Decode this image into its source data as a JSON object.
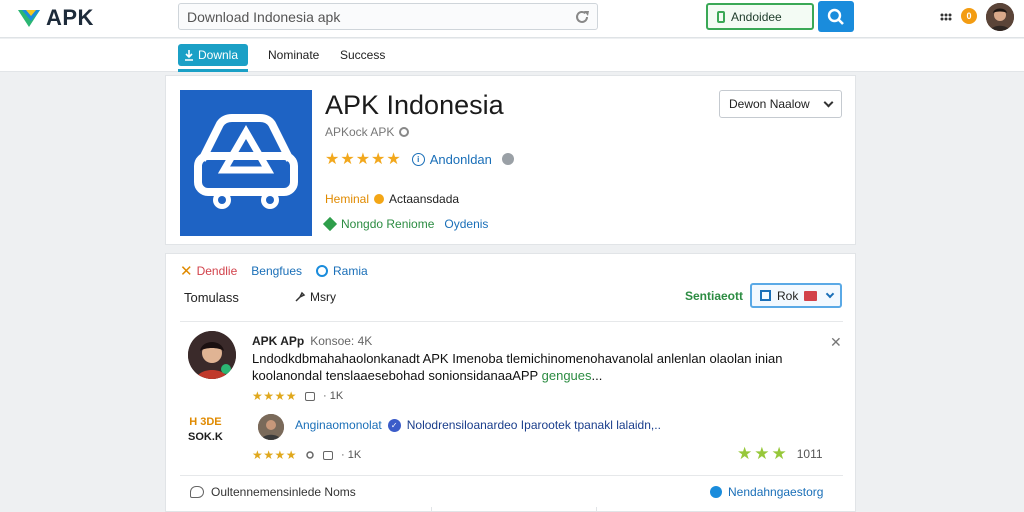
{
  "header": {
    "logo_text": "APK",
    "search_placeholder": "Download Indonesia apk",
    "primary_button": "Andoidee",
    "notification_count": "0"
  },
  "tabs": [
    {
      "label": "Downla"
    },
    {
      "label": "Nominate"
    },
    {
      "label": "Success"
    }
  ],
  "app": {
    "title": "APK Indonesia",
    "subtitle": "APKock APK",
    "rating_stars": "★★★★★",
    "rating_label": "Andonldan",
    "meta_orange_label": "Heminal",
    "meta_orange_value": "Actaansdada",
    "meta_green_label": "Nongdo Reniome",
    "meta_blue_label": "Oydenis",
    "dropdown_label": "Dewon Naalow"
  },
  "reviews": {
    "filters": [
      "Dendlie",
      "Bengfues",
      "Ramia"
    ],
    "sort_label": "Tomulass",
    "sort_option": "Msry",
    "sentiment_label": "Sentiaeott",
    "select_label": "Rok",
    "review1": {
      "name": "APK APp",
      "time": "Konsoe: 4K",
      "body_line1": "Lndodkdbmahahaolonkanadt APK Imenoba tlemichinomenohavanolal anlenlan olaolan inian",
      "body_line2": "koolanondal tenslaaesebohad sonionsidanaaAPP",
      "body_highlight": "gengues",
      "stars": "★★★★",
      "count": "· 1K"
    },
    "badge_line1": "H 3DE",
    "badge_line2": "SOK.K",
    "review2": {
      "name": "Anginaomonolat",
      "text": "Nolodrensiloanardeo Iparootek tpanakl lalaidn,..",
      "stars": "★★★★",
      "count": "· 1K",
      "right_stars": "★★★",
      "right_count": "1011"
    },
    "footer_text": "Oultennemensinlede Noms",
    "footer_link": "Nendahngaestorg"
  },
  "colors": {
    "accent_blue": "#1a8cdc",
    "accent_green": "#3aa856",
    "star_orange": "#f2a81d",
    "app_icon_bg": "#1e63c4"
  }
}
